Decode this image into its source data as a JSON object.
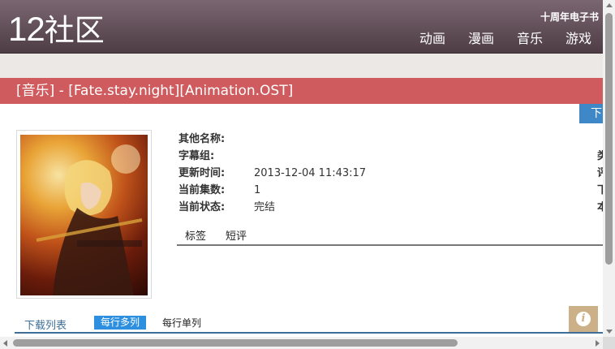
{
  "header": {
    "logo_num": "12",
    "logo_text": "社区",
    "top_link": "十周年电子书",
    "nav": [
      "动画",
      "漫画",
      "音乐",
      "游戏"
    ]
  },
  "title": "[音乐] - [Fate.stay.night][Animation.OST]",
  "download_button": "下",
  "poster": {
    "image": "anime-album-cover-image"
  },
  "info": [
    {
      "key": "其他名称:",
      "value": ""
    },
    {
      "key": "字幕组:",
      "value": ""
    },
    {
      "key": "更新时间:",
      "value": "2013-12-04 11:43:17"
    },
    {
      "key": "当前集数:",
      "value": "1"
    },
    {
      "key": "当前状态:",
      "value": "完结"
    }
  ],
  "right_column_cut": [
    "类",
    "评",
    "下",
    "本"
  ],
  "tabs": [
    "标签",
    "短评"
  ],
  "download_list": {
    "label": "下载列表",
    "mode_multi": "每行多列",
    "mode_single": "每行单列"
  },
  "info_icon": "i",
  "colors": {
    "header": "#5e4b54",
    "title_bar": "#cf5b5e",
    "accent_blue": "#2d8fe0",
    "info_button": "#cbb088"
  }
}
